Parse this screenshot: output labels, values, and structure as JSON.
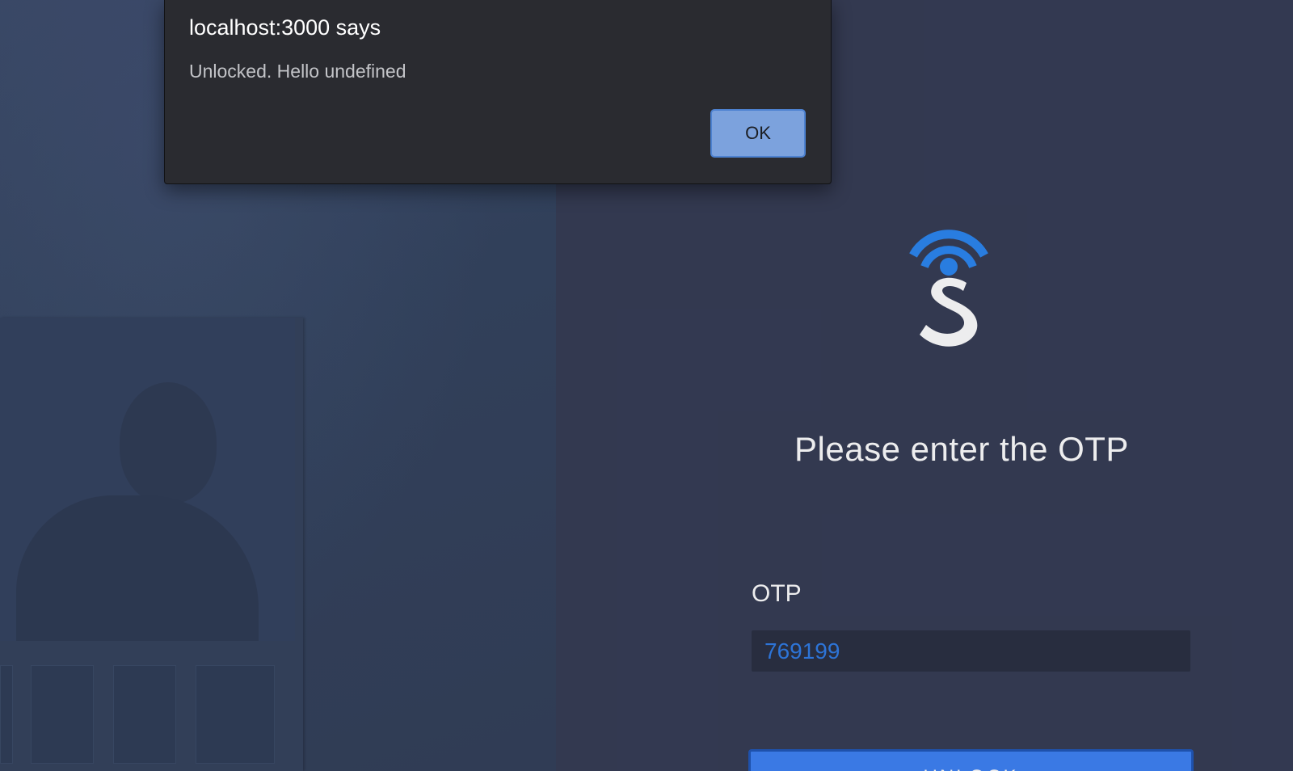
{
  "dialog": {
    "title": "localhost:3000 says",
    "message": "Unlocked. Hello undefined",
    "ok_label": "OK"
  },
  "login": {
    "logo_icon": "brand-s-wifi-logo",
    "title": "Please enter the OTP",
    "otp_label": "OTP",
    "otp_value": "769199",
    "unlock_label": "UNLOCK"
  },
  "colors": {
    "background": "#363c53",
    "accent_blue": "#3d82f5",
    "otp_text": "#2f7ce6",
    "dialog_bg": "#2a2b30",
    "ok_button": "#7ca2dd"
  }
}
